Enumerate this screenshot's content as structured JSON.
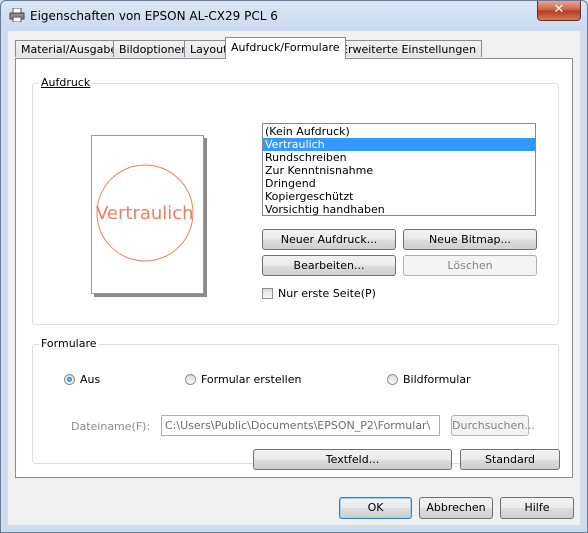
{
  "window": {
    "title": "Eigenschaften von EPSON AL-CX29 PCL 6",
    "close_glyph": "✕"
  },
  "tabs": [
    {
      "label": "Material/Ausgabe"
    },
    {
      "label": "Bildoptionen"
    },
    {
      "label": "Layout"
    },
    {
      "label": "Aufdruck/Formulare",
      "active": true
    },
    {
      "label": "Erweiterte Einstellungen"
    }
  ],
  "aufdruck": {
    "group_label": "Aufdruck",
    "preview_text": "Vertraulich",
    "preview_color": "#e8805e",
    "list_items": [
      "(Kein Aufdruck)",
      "Vertraulich",
      "Rundschreiben",
      "Zur Kenntnisnahme",
      "Dringend",
      "Kopiergeschützt",
      "Vorsichtig handhaben"
    ],
    "selected_item": "Vertraulich",
    "buttons": {
      "neuer_aufdruck": "Neuer Aufdruck...",
      "neue_bitmap": "Neue Bitmap...",
      "bearbeiten": "Bearbeiten...",
      "loeschen": "Löschen"
    },
    "first_page_only": {
      "label": "Nur erste Seite(P)",
      "checked": false
    }
  },
  "formulare": {
    "group_label": "Formulare",
    "radios": [
      {
        "label": "Aus",
        "selected": true
      },
      {
        "label": "Formular erstellen",
        "selected": false
      },
      {
        "label": "Bildformular",
        "selected": false
      }
    ],
    "filename_label": "Dateiname(F):",
    "filename_value": "C:\\Users\\Public\\Documents\\EPSON_P2\\Formular\\",
    "browse_button": "Durchsuchen..."
  },
  "panel_buttons": {
    "textfeld": "Textfeld...",
    "standard": "Standard"
  },
  "dialog_buttons": {
    "ok": "OK",
    "abbrechen": "Abbrechen",
    "hilfe": "Hilfe"
  },
  "colors": {
    "selection": "#3399ff",
    "title_bar": "#cfdced",
    "close_button": "#c95c42"
  }
}
